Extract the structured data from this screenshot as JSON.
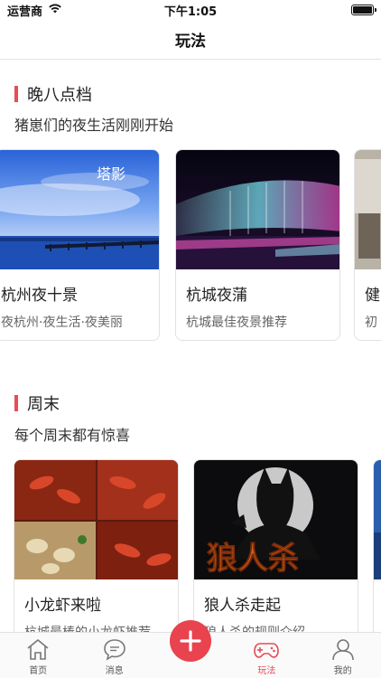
{
  "status_bar": {
    "carrier": "运营商",
    "time": "下午1:05"
  },
  "nav": {
    "title": "玩法"
  },
  "sections": [
    {
      "title": "晚八点档",
      "subtitle": "猪崽们的夜生活刚刚开始",
      "cards": [
        {
          "title": "杭州夜十景",
          "desc": "夜杭州·夜生活·夜美丽",
          "image_overlay": "塔影"
        },
        {
          "title": "杭城夜蒲",
          "desc": "杭城最佳夜景推荐"
        },
        {
          "title": "健",
          "desc": "初"
        }
      ]
    },
    {
      "title": "周末",
      "subtitle": "每个周末都有惊喜",
      "cards": [
        {
          "title": "小龙虾来啦",
          "desc": "杭城最棒的小龙虾推荐"
        },
        {
          "title": "狼人杀走起",
          "desc": "狼人杀的规则介绍",
          "image_overlay": "狼人杀"
        }
      ]
    }
  ],
  "tabs": [
    {
      "label": "首页",
      "icon": "home-icon"
    },
    {
      "label": "消息",
      "icon": "message-icon"
    },
    {
      "label": "",
      "icon": "plus-icon"
    },
    {
      "label": "玩法",
      "icon": "gamepad-icon",
      "active": true
    },
    {
      "label": "我的",
      "icon": "profile-icon"
    }
  ],
  "colors": {
    "accent": "#e84c57",
    "plus_button": "#e8434f"
  }
}
